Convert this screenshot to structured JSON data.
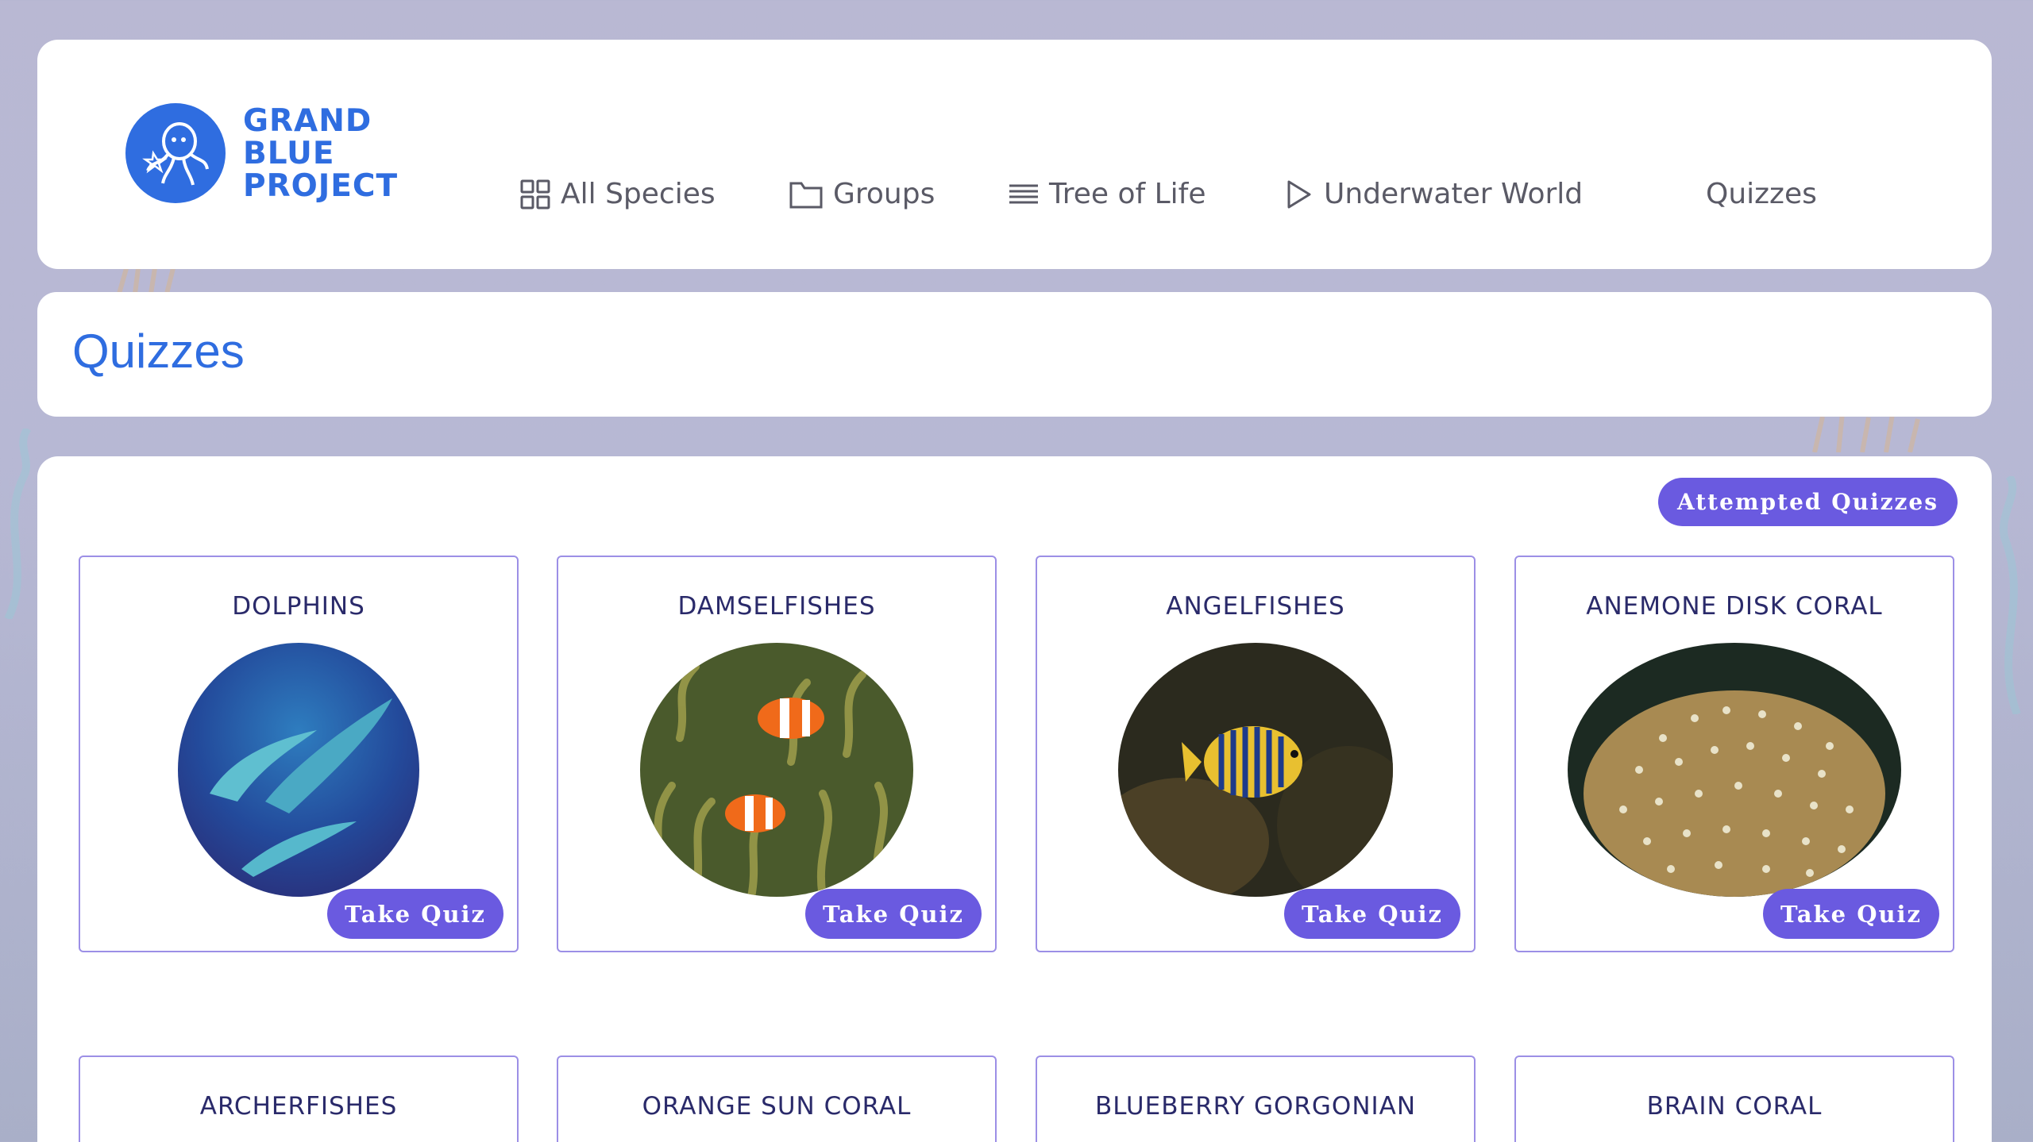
{
  "header": {
    "logo": {
      "line1": "GRAND",
      "line2": "BLUE",
      "line3": "PROJECT",
      "icon": "octopus-icon"
    },
    "nav": [
      {
        "label": "All Species",
        "icon": "grid-icon"
      },
      {
        "label": "Groups",
        "icon": "folder-icon"
      },
      {
        "label": "Tree of Life",
        "icon": "list-icon"
      },
      {
        "label": "Underwater World",
        "icon": "play-icon"
      },
      {
        "label": "Quizzes"
      }
    ]
  },
  "page": {
    "title": "Quizzes"
  },
  "main": {
    "attempted_label": "Attempted Quizzes",
    "take_quiz_label": "Take Quiz",
    "row1": [
      {
        "title": "DOLPHINS"
      },
      {
        "title": "DAMSELFISHES"
      },
      {
        "title": "ANGELFISHES"
      },
      {
        "title": "ANEMONE DISK CORAL"
      }
    ],
    "row2": [
      {
        "title": "ARCHERFISHES"
      },
      {
        "title": "ORANGE SUN CORAL"
      },
      {
        "title": "BLUEBERRY GORGONIAN"
      },
      {
        "title": "BRAIN CORAL"
      }
    ]
  },
  "colors": {
    "brand_blue": "#2f6de0",
    "button_purple": "#6a5ae0",
    "card_border": "#9c8fe6",
    "background": "#b9b8d3"
  }
}
